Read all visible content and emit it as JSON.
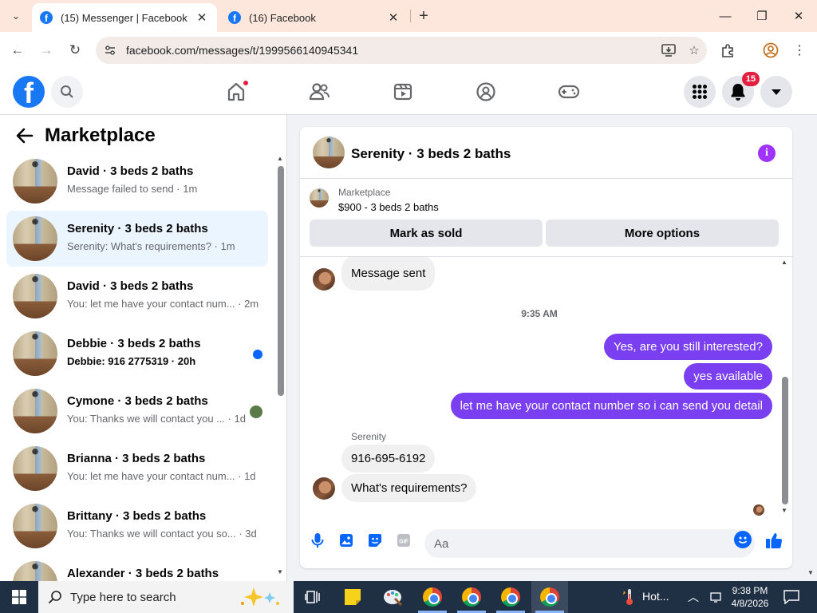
{
  "browser": {
    "tabs": [
      {
        "title": "(15) Messenger | Facebook",
        "active": true
      },
      {
        "title": "(16) Facebook",
        "active": false
      }
    ],
    "url": "facebook.com/messages/t/1999566140945341"
  },
  "facebook": {
    "logo_letter": "f",
    "notification_count": "15",
    "home_has_dot": true
  },
  "sidebar": {
    "title": "Marketplace",
    "conversations": [
      {
        "name": "David · 3 beds 2 baths",
        "preview": "Message failed to send · 1m",
        "selected": false
      },
      {
        "name": "Serenity · 3 beds 2 baths",
        "preview": "Serenity: What's requirements? · 1m",
        "selected": true
      },
      {
        "name": "David · 3 beds 2 baths",
        "preview": "You: let me have your contact num... · 2m",
        "selected": false
      },
      {
        "name": "Debbie · 3 beds 2 baths",
        "preview": "Debbie: 916 2775319 · 20h",
        "selected": false,
        "unread": true
      },
      {
        "name": "Cymone · 3 beds 2 baths",
        "preview": "You: Thanks we will contact you ... · 1d",
        "selected": false
      },
      {
        "name": "Brianna · 3 beds 2 baths",
        "preview": "You: let me have your contact num... · 1d",
        "selected": false
      },
      {
        "name": "Brittany · 3 beds 2 baths",
        "preview": "You: Thanks we will contact you so... · 3d",
        "selected": false
      },
      {
        "name": "Alexander · 3 beds 2 baths",
        "preview": "",
        "selected": false
      }
    ]
  },
  "chat": {
    "title": "Serenity · 3 beds 2 baths",
    "marketplace_label": "Marketplace",
    "listing": "$900 - 3 beds 2 baths",
    "buttons": {
      "mark_sold": "Mark as sold",
      "more_options": "More options"
    },
    "messages": {
      "sent_status": "Message sent",
      "timestamp": "9:35 AM",
      "out1": "Yes, are you still interested?",
      "out2": "yes available",
      "out3": "let me have your contact number so i can send you detail",
      "sender_name": "Serenity",
      "in1": "916-695-6192",
      "in2": "What's requirements?"
    },
    "composer_placeholder": "Aa",
    "colors": {
      "outgoing_bubble": "#7b3ff2",
      "accent": "#a033ff"
    }
  },
  "taskbar": {
    "search_placeholder": "Type here to search",
    "weather": "Hot...",
    "time": "9:38 PM",
    "date": "4/8/2026"
  }
}
